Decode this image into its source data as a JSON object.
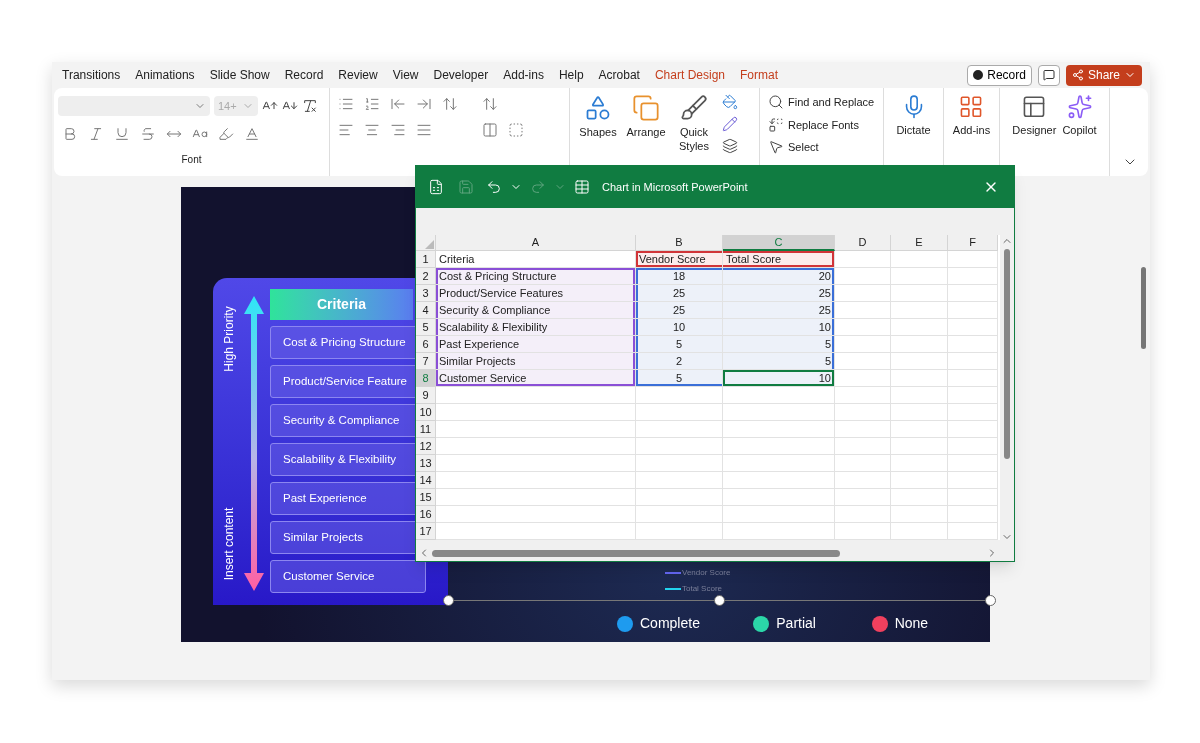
{
  "ribbon_tabs": [
    {
      "label": "Transitions",
      "kind": "standard"
    },
    {
      "label": "Animations",
      "kind": "standard"
    },
    {
      "label": "Slide Show",
      "kind": "standard"
    },
    {
      "label": "Record",
      "kind": "standard"
    },
    {
      "label": "Review",
      "kind": "standard"
    },
    {
      "label": "View",
      "kind": "standard"
    },
    {
      "label": "Developer",
      "kind": "standard"
    },
    {
      "label": "Add-ins",
      "kind": "standard"
    },
    {
      "label": "Help",
      "kind": "standard"
    },
    {
      "label": "Acrobat",
      "kind": "standard"
    },
    {
      "label": "Chart Design",
      "kind": "contextual"
    },
    {
      "label": "Format",
      "kind": "contextual"
    }
  ],
  "record_button": "Record",
  "share_button": "Share",
  "ribbon": {
    "font_size_placeholder": "14+",
    "font_group_label": "Font",
    "drawing_buttons": [
      "Shapes",
      "Arrange",
      "Quick Styles"
    ],
    "editing_buttons": [
      "Find and Replace",
      "Replace Fonts",
      "Select"
    ],
    "dictate_button": "Dictate",
    "addins_button": "Add-ins",
    "designer_button": "Designer",
    "copilot_button": "Copilot"
  },
  "slide": {
    "axis_top": "High Priority",
    "axis_bottom": "Insert content",
    "criteria_header": "Criteria",
    "criteria": [
      "Cost & Pricing Structure",
      "Product/Service Feature",
      "Security & Compliance",
      "Scalability & Flexibility",
      "Past Experience",
      "Similar Projects",
      "Customer Service"
    ],
    "chart_legend": [
      {
        "label": "Vendor Score",
        "color": "#6366f1"
      },
      {
        "label": "Total Score",
        "color": "#22d3ee"
      }
    ],
    "status_legend": [
      {
        "label": "Complete",
        "color": "#1e9bef"
      },
      {
        "label": "Partial",
        "color": "#2bd6a8"
      },
      {
        "label": "None",
        "color": "#f0405e"
      }
    ]
  },
  "sheet": {
    "title": "Chart in Microsoft PowerPoint",
    "columns": [
      {
        "label": "A",
        "selected": false
      },
      {
        "label": "B",
        "selected": false
      },
      {
        "label": "C",
        "selected": true
      },
      {
        "label": "D",
        "selected": false
      },
      {
        "label": "E",
        "selected": false
      },
      {
        "label": "F",
        "selected": false
      }
    ],
    "rows": [
      {
        "number": "1",
        "selected": false,
        "cells": [
          "Criteria",
          "Vendor Score",
          "Total Score"
        ]
      },
      {
        "number": "2",
        "selected": false,
        "cells": [
          "Cost & Pricing Structure",
          "18",
          "20"
        ]
      },
      {
        "number": "3",
        "selected": false,
        "cells": [
          "Product/Service Features",
          "25",
          "25"
        ]
      },
      {
        "number": "4",
        "selected": false,
        "cells": [
          "Security & Compliance",
          "25",
          "25"
        ]
      },
      {
        "number": "5",
        "selected": false,
        "cells": [
          "Scalability & Flexibility",
          "10",
          "10"
        ]
      },
      {
        "number": "6",
        "selected": false,
        "cells": [
          "Past Experience",
          "5",
          "5"
        ]
      },
      {
        "number": "7",
        "selected": false,
        "cells": [
          "Similar Projects",
          "2",
          "5"
        ]
      },
      {
        "number": "8",
        "selected": true,
        "cells": [
          "Customer Service",
          "5",
          "10"
        ]
      },
      {
        "number": "9",
        "selected": false,
        "cells": []
      },
      {
        "number": "10",
        "selected": false,
        "cells": []
      },
      {
        "number": "11",
        "selected": false,
        "cells": []
      },
      {
        "number": "12",
        "selected": false,
        "cells": []
      },
      {
        "number": "13",
        "selected": false,
        "cells": []
      },
      {
        "number": "14",
        "selected": false,
        "cells": []
      },
      {
        "number": "15",
        "selected": false,
        "cells": []
      },
      {
        "number": "16",
        "selected": false,
        "cells": []
      },
      {
        "number": "17",
        "selected": false,
        "cells": []
      }
    ]
  }
}
